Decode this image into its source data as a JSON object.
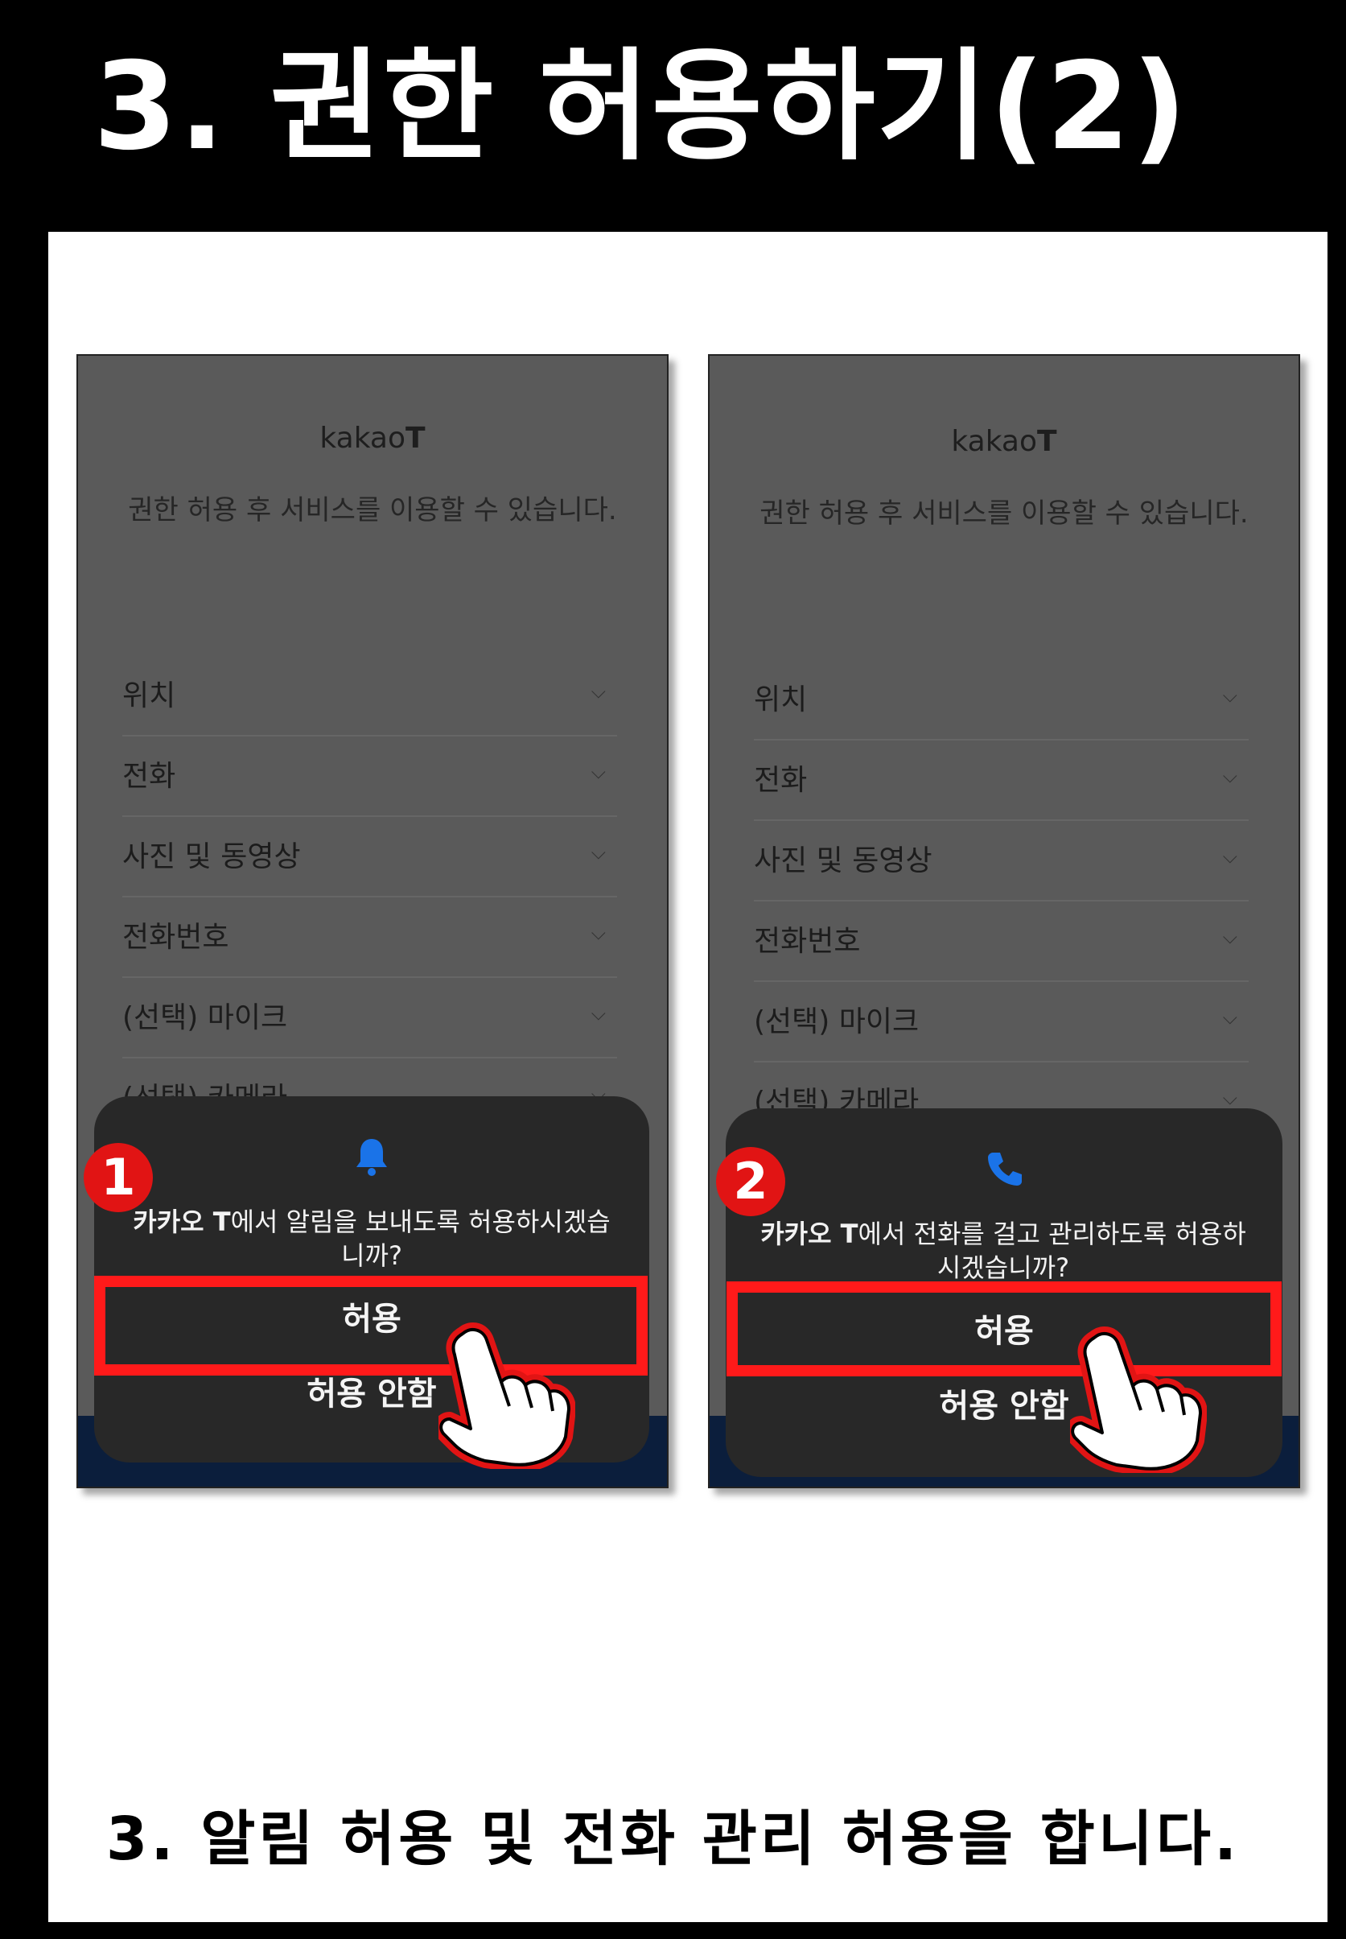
{
  "header": {
    "title": "3. 권한 허용하기(2)"
  },
  "screens": [
    {
      "brand_light": "kakao",
      "brand_bold": "T",
      "subtitle": "권한 허용 후 서비스를 이용할 수 있습니다.",
      "permissions": [
        "위치",
        "전화",
        "사진 및 동영상",
        "전화번호",
        "(선택) 마이크",
        "(선택) 카메라"
      ],
      "dialog": {
        "icon": "bell-icon",
        "app_name": "카카오 T",
        "message": "에서 알림을 보내도록 허용하시겠습니까?",
        "allow_label": "허용",
        "deny_label": "허용 안함"
      },
      "step_number": "1"
    },
    {
      "brand_light": "kakao",
      "brand_bold": "T",
      "subtitle": "권한 허용 후 서비스를 이용할 수 있습니다.",
      "permissions": [
        "위치",
        "전화",
        "사진 및 동영상",
        "전화번호",
        "(선택) 마이크",
        "(선택) 카메라"
      ],
      "dialog": {
        "icon": "phone-icon",
        "app_name": "카카오 T",
        "message": "에서 전화를 걸고 관리하도록 허용하시겠습니까?",
        "allow_label": "허용",
        "deny_label": "허용 안함"
      },
      "step_number": "2"
    }
  ],
  "caption": "3. 알림 허용 및 전화 관리 허용을 합니다.",
  "colors": {
    "highlight": "#ff1a1a",
    "badge": "#e11414",
    "icon_blue": "#1a73e8",
    "dialog_bg": "#282828",
    "screen_bg": "#5a5a5a"
  }
}
